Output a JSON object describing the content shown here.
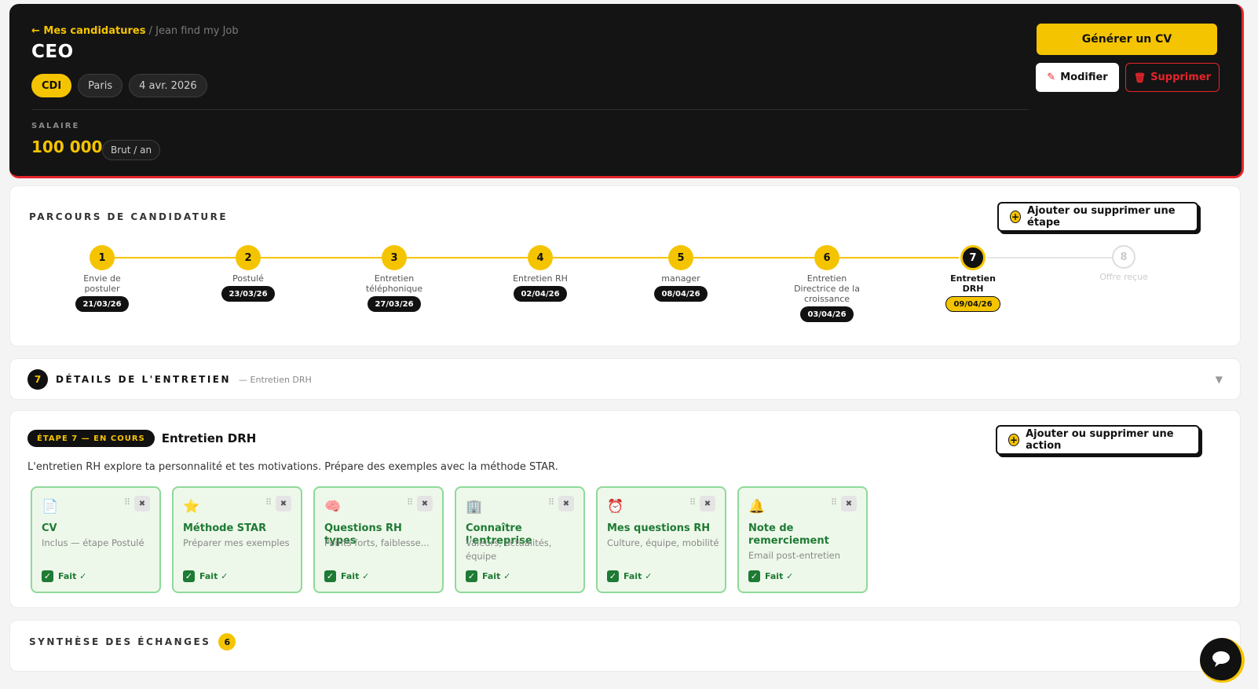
{
  "header": {
    "breadcrumb_back": "← Mes candidatures",
    "breadcrumb_sep": " / ",
    "breadcrumb_current": "Jean find my Job",
    "title": "CEO",
    "tags": [
      "CDI",
      "Paris",
      "4 avr. 2026"
    ],
    "salary_label": "SALAIRE",
    "salary_value": "100 000",
    "salary_unit": "Brut / an",
    "generate_cv_label": "Générer un CV",
    "edit_label": "Modifier",
    "delete_label": "Supprimer"
  },
  "timeline": {
    "title": "PARCOURS DE CANDIDATURE",
    "manage_steps_label": "Ajouter ou supprimer une étape",
    "current_step": 7,
    "steps": [
      {
        "num": "1",
        "label": "Envie de postuler",
        "date": "21/03/26",
        "state": "done"
      },
      {
        "num": "2",
        "label": "Postulé",
        "date": "23/03/26",
        "state": "done"
      },
      {
        "num": "3",
        "label": "Entretien téléphonique",
        "date": "27/03/26",
        "state": "done"
      },
      {
        "num": "4",
        "label": "Entretien RH",
        "date": "02/04/26",
        "state": "done"
      },
      {
        "num": "5",
        "label": "manager",
        "date": "08/04/26",
        "state": "done"
      },
      {
        "num": "6",
        "label": "Entretien Directrice de la croissance",
        "date": "03/04/26",
        "state": "done"
      },
      {
        "num": "7",
        "label": "Entretien DRH",
        "date": "09/04/26",
        "state": "current"
      },
      {
        "num": "8",
        "label": "Offre reçue",
        "date": "",
        "state": "future"
      }
    ]
  },
  "details": {
    "number": "7",
    "title": "DÉTAILS DE L'ENTRETIEN",
    "subtitle": "— Entretien DRH"
  },
  "stage": {
    "badge": "ÉTAPE 7 — EN COURS",
    "title": "Entretien DRH",
    "description": "L'entretien RH explore ta personnalité et tes motivations. Prépare des exemples avec la méthode STAR.",
    "manage_actions_label": "Ajouter ou supprimer une action",
    "actions": [
      {
        "icon": "📄",
        "icon_name": "document-icon",
        "title": "CV",
        "desc": "Inclus — étape Postulé",
        "done": "Fait ✓"
      },
      {
        "icon": "⭐",
        "icon_name": "star-icon",
        "title": "Méthode STAR",
        "desc": "Préparer mes exemples",
        "done": "Fait ✓"
      },
      {
        "icon": "🧠",
        "icon_name": "brain-icon",
        "title": "Questions RH types",
        "desc": "Points forts, faiblesse...",
        "done": "Fait ✓"
      },
      {
        "icon": "🏢",
        "icon_name": "building-icon",
        "title": "Connaître l'entreprise",
        "desc": "Valeurs, actualités, équipe",
        "done": "Fait ✓"
      },
      {
        "icon": "⏰",
        "icon_name": "alarm-clock-icon",
        "title": "Mes questions RH",
        "desc": "Culture, équipe, mobilité",
        "done": "Fait ✓"
      },
      {
        "icon": "🔔",
        "icon_name": "bell-icon",
        "title": "Note de remerciement",
        "desc": "Email post-entretien",
        "done": "Fait ✓"
      }
    ]
  },
  "synthese": {
    "title": "SYNTHÈSE DES ÉCHANGES",
    "count": "6"
  },
  "colors": {
    "accent": "#f5c400",
    "danger": "#e5252b",
    "success": "#1e7a34",
    "dark": "#141414"
  }
}
